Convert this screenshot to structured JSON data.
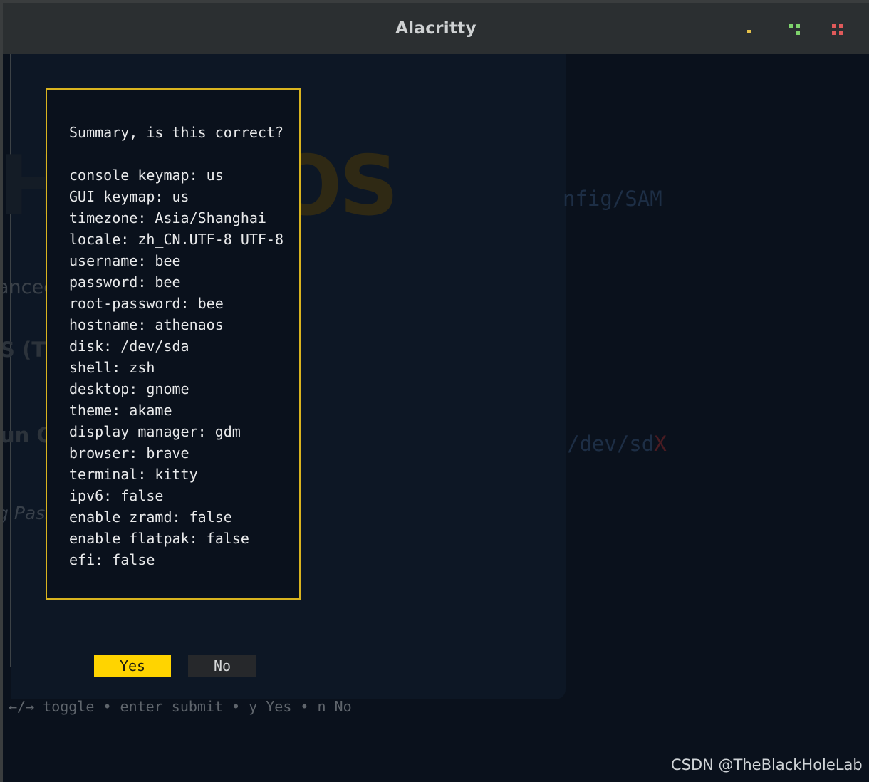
{
  "window": {
    "title": "Alacritty",
    "controls": [
      {
        "name": "minimize",
        "color": "#e6c24a"
      },
      {
        "name": "maximize",
        "color": "#7ed36c"
      },
      {
        "name": "close",
        "color": "#e05a5a"
      }
    ]
  },
  "background": {
    "logo_left": "HENA",
    "logo_right": "OS",
    "line1": "anced Installation fails",
    "line2": "S (TUI)",
    "line3": "un GParted",
    "line4": "g Passw",
    "right1": "nfig/SAM",
    "right2a": "/dev/sd",
    "right2b": "X"
  },
  "dialog": {
    "heading": "Summary, is this correct?",
    "lines": [
      "console keymap: us",
      "GUI keymap: us",
      "timezone: Asia/Shanghai",
      "locale: zh_CN.UTF-8 UTF-8",
      "username: bee",
      "password: bee",
      "root-password: bee",
      "hostname: athenaos",
      "disk: /dev/sda",
      "shell: zsh",
      "desktop: gnome",
      "theme: akame",
      "display manager: gdm",
      "browser: brave",
      "terminal: kitty",
      "ipv6: false",
      "enable zramd: false",
      "enable flatpak: false",
      "efi: false"
    ]
  },
  "buttons": {
    "yes": "Yes",
    "no": "No"
  },
  "help": "←/→ toggle • enter submit • y Yes • n No",
  "watermark": "CSDN @TheBlackHoleLab",
  "colors": {
    "accent_yellow": "#ffd400",
    "dialog_border": "#d9b41f",
    "terminal_bg": "#0a111c"
  }
}
